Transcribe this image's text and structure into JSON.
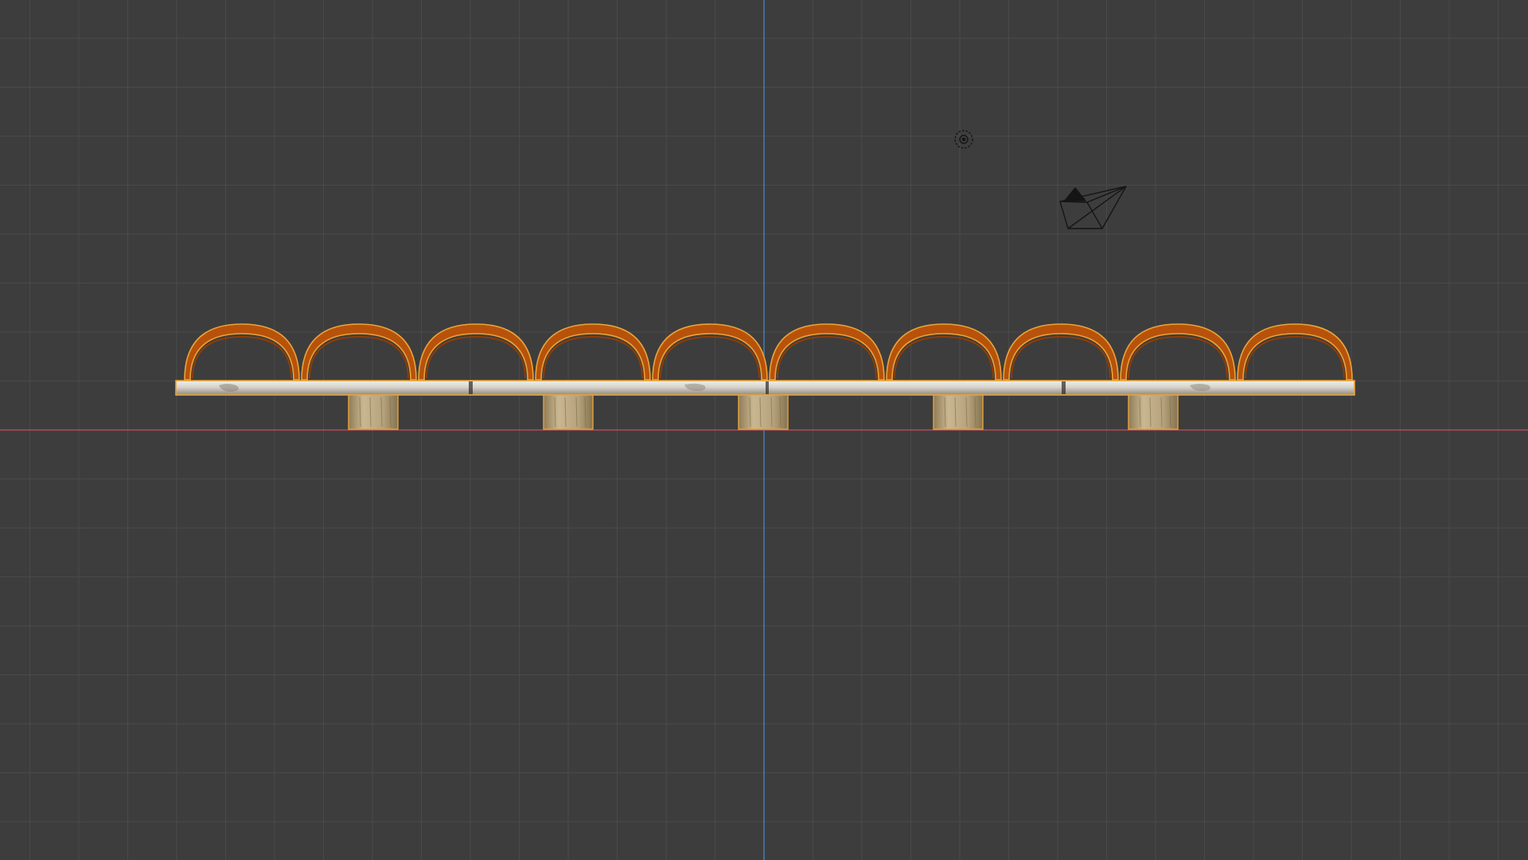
{
  "editor": "3d-viewport",
  "view": "front-orthographic",
  "colors": {
    "background": "#3d3d3d",
    "grid_minor": "#4a4a4a",
    "grid_major": "#545454",
    "axis_x": "#c4515c",
    "axis_z": "#4d84c2",
    "selection_outline": "#e8a43a",
    "arch_fill": "#b8520a",
    "arch_inner": "#8f3c05",
    "plank_fill": "#d6d2c8",
    "post_fill": "#b7a47f",
    "gizmo": "#151515"
  },
  "scene": {
    "arch_count": 10,
    "post_count": 5
  },
  "icons": {
    "camera": "camera-object-icon",
    "light": "light-object-icon"
  }
}
